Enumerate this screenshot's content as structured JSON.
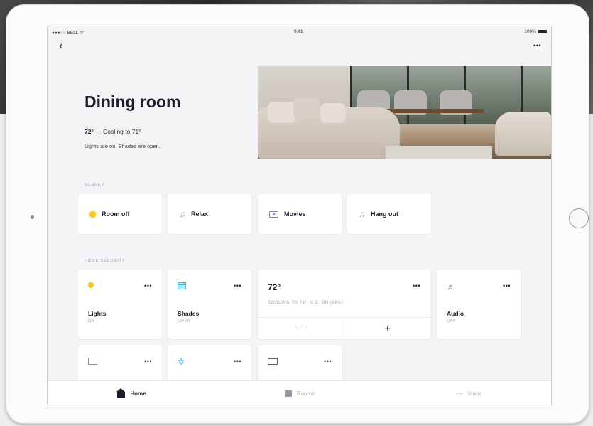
{
  "status_bar": {
    "carrier": "●●●○○ BELL ᯤ",
    "time": "9:41",
    "battery": "100%"
  },
  "nav": {
    "back_icon": "chevron-left-icon",
    "back_glyph": "‹",
    "more_glyph": "•••"
  },
  "room": {
    "title": "Dining room",
    "temperature": "72°",
    "temp_detail": " — Cooling to 71°",
    "status": "Lights are on. Shades are open."
  },
  "scenes": {
    "section_label": "SCENES",
    "items": [
      {
        "label": "Room off",
        "icon": "sun-icon"
      },
      {
        "label": "Relax",
        "icon": "music-note-icon"
      },
      {
        "label": "Movies",
        "icon": "tv-icon"
      },
      {
        "label": "Hang out",
        "icon": "music-note-icon"
      }
    ]
  },
  "security": {
    "section_label": "HOME SECURITY",
    "devices": [
      {
        "name": "Lights",
        "state": "ON",
        "icon": "bulb-icon"
      },
      {
        "name": "Shades",
        "state": "OPEN",
        "icon": "shades-icon"
      },
      {
        "name": "Audio",
        "state": "OFF",
        "icon": "music-icon"
      }
    ],
    "thermostat": {
      "temp": "72°",
      "status": "COOLING TO 71°, H.C. ON (56%)",
      "minus": "—",
      "plus": "+"
    },
    "row2": [
      {
        "icon": "screen-icon"
      },
      {
        "icon": "fan-icon"
      },
      {
        "icon": "frame-icon"
      }
    ],
    "more_glyph": "•••"
  },
  "tabbar": {
    "tabs": [
      {
        "label": "Home",
        "icon": "home-icon",
        "active": true
      },
      {
        "label": "Rooms",
        "icon": "rooms-icon",
        "active": false
      },
      {
        "label": "More",
        "icon": "dots-icon",
        "active": false
      }
    ],
    "dots_glyph": "•••"
  },
  "colors": {
    "accent_yellow": "#f5c518",
    "accent_green": "#5fc9a0",
    "accent_purple": "#9b6dd4",
    "accent_blue": "#3fb4e6",
    "text_dark": "#1d1d2b"
  }
}
